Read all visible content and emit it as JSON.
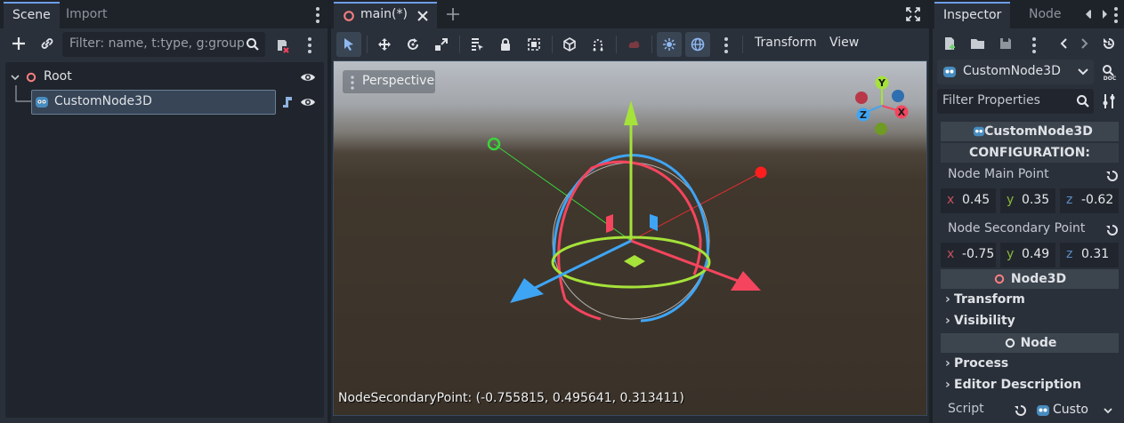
{
  "scene_dock": {
    "tabs": [
      "Scene",
      "Import"
    ],
    "filter_placeholder": "Filter: name, t:type, g:group",
    "tree": [
      {
        "label": "Root",
        "icon": "node-circle-icon",
        "visible": true
      },
      {
        "label": "CustomNode3D",
        "icon": "godot-node-icon",
        "visible": true,
        "selected": true,
        "has_script": true
      }
    ]
  },
  "editor": {
    "tab_label": "main(*)",
    "toolbar": {
      "transform_menu": "Transform",
      "view_menu": "View"
    },
    "viewport": {
      "perspective_label": "Perspective",
      "gizmo_axes": {
        "x": "X",
        "y": "Y",
        "z": "Z"
      },
      "info_text": "NodeSecondaryPoint: (-0.755815, 0.495641, 0.313411)"
    }
  },
  "inspector": {
    "tabs": [
      "Inspector",
      "Node"
    ],
    "object_name": "CustomNode3D",
    "filter_placeholder": "Filter Properties",
    "class_header": "CustomNode3D",
    "config_label": "CONFIGURATION:",
    "main_point": {
      "label": "Node Main Point",
      "x": "0.45",
      "y": "0.35",
      "z": "-0.62"
    },
    "secondary_point": {
      "label": "Node Secondary Point",
      "x": "-0.75",
      "y": "0.49",
      "z": "0.31"
    },
    "node3d_header": "Node3D",
    "node3d_groups": [
      "Transform",
      "Visibility"
    ],
    "node_header": "Node",
    "node_groups": [
      "Process",
      "Editor Description"
    ],
    "script_label": "Script",
    "script_value": "Custo",
    "axis_labels": {
      "x": "x",
      "y": "y",
      "z": "z"
    }
  },
  "colors": {
    "accent": "#6e9ee8",
    "x_axis": "#f5455e",
    "y_axis": "#a5e23a",
    "z_axis": "#3ea5f5"
  }
}
